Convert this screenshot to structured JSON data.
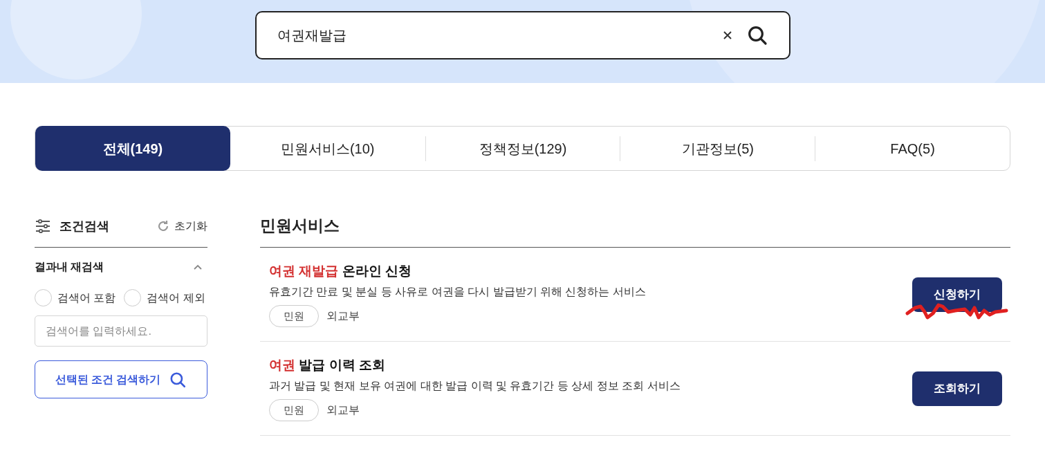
{
  "search": {
    "value": "여권재발급"
  },
  "tabs": [
    {
      "label": "전체(149)",
      "selected": true
    },
    {
      "label": "민원서비스(10)",
      "selected": false
    },
    {
      "label": "정책정보(129)",
      "selected": false
    },
    {
      "label": "기관정보(5)",
      "selected": false
    },
    {
      "label": "FAQ(5)",
      "selected": false
    }
  ],
  "filter": {
    "title": "조건검색",
    "reset": "초기화",
    "section": {
      "title": "결과내 재검색",
      "expanded": true
    },
    "options": [
      {
        "label": "검색어 포함",
        "selected": false
      },
      {
        "label": "검색어 제외",
        "selected": false
      }
    ],
    "placeholder": "검색어를 입력하세요.",
    "submit": "선택된 조건 검색하기"
  },
  "results": {
    "heading": "민원서비스",
    "items": [
      {
        "title": [
          {
            "text": "여권 재발급",
            "highlight": true
          },
          {
            "text": " 온라인 신청",
            "highlight": false
          }
        ],
        "description": "유효기간 만료 및 분실 등 사유로 여권을 다시 발급받기 위해 신청하는 서비스",
        "tag": "민원",
        "agency": "외교부",
        "action": "신청하기",
        "scribbled": true
      },
      {
        "title": [
          {
            "text": "여권",
            "highlight": true
          },
          {
            "text": " 발급 이력 조회",
            "highlight": false
          }
        ],
        "description": "과거 발급 및 현재 보유 여권에 대한 발급 이력 및 유효기간 등 상세 정보 조회 서비스",
        "tag": "민원",
        "agency": "외교부",
        "action": "조회하기",
        "scribbled": false
      }
    ]
  }
}
